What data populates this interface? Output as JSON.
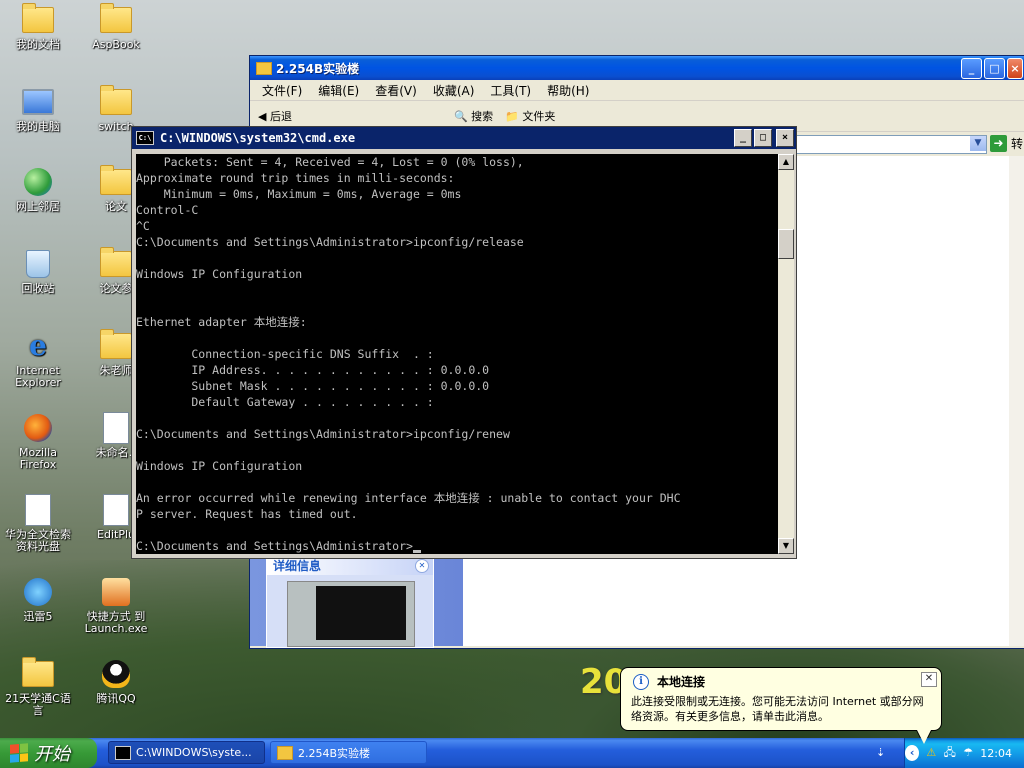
{
  "desktop": {
    "icons": [
      {
        "label": "我的文档",
        "icon": "my-documents-icon"
      },
      {
        "label": "AspBook",
        "icon": "folder-icon"
      },
      {
        "label": "我的电脑",
        "icon": "my-computer-icon"
      },
      {
        "label": "switch",
        "icon": "folder-icon"
      },
      {
        "label": "网上邻居",
        "icon": "network-places-icon"
      },
      {
        "label": "论文",
        "icon": "folder-icon"
      },
      {
        "label": "回收站",
        "icon": "recycle-bin-icon"
      },
      {
        "label": "论文参",
        "icon": "folder-icon"
      },
      {
        "label": "Internet Explorer",
        "icon": "internet-explorer-icon"
      },
      {
        "label": "朱老师",
        "icon": "folder-icon"
      },
      {
        "label": "Mozilla Firefox",
        "icon": "firefox-icon"
      },
      {
        "label": "未命名.t",
        "icon": "document-icon"
      },
      {
        "label": "华为全文检索资料光盘",
        "icon": "huawei-cd-icon"
      },
      {
        "label": "EditPlu",
        "icon": "editplus-icon"
      },
      {
        "label": "迅雷5",
        "icon": "xunlei-icon"
      },
      {
        "label": "快捷方式 到 Launch.exe",
        "icon": "game-shortcut-icon"
      },
      {
        "label": "21天学通C语言",
        "icon": "folder-icon"
      },
      {
        "label": "腾讯QQ",
        "icon": "qq-icon"
      }
    ],
    "background_big_text": "20"
  },
  "explorer": {
    "title": "2.254B实验楼",
    "menu": [
      "文件(F)",
      "编辑(E)",
      "查看(V)",
      "收藏(A)",
      "工具(T)",
      "帮助(H)"
    ],
    "toolbar": {
      "back": "后退",
      "search": "搜索",
      "folders": "文件夹"
    },
    "go_label": "转",
    "details_header": "详细信息"
  },
  "cmd": {
    "title": "C:\\WINDOWS\\system32\\cmd.exe",
    "lines": [
      "    Packets: Sent = 4, Received = 4, Lost = 0 (0% loss),",
      "Approximate round trip times in milli-seconds:",
      "    Minimum = 0ms, Maximum = 0ms, Average = 0ms",
      "Control-C",
      "^C",
      "C:\\Documents and Settings\\Administrator>ipconfig/release",
      "",
      "Windows IP Configuration",
      "",
      "",
      "Ethernet adapter 本地连接:",
      "",
      "        Connection-specific DNS Suffix  . :",
      "        IP Address. . . . . . . . . . . . : 0.0.0.0",
      "        Subnet Mask . . . . . . . . . . . : 0.0.0.0",
      "        Default Gateway . . . . . . . . . :",
      "",
      "C:\\Documents and Settings\\Administrator>ipconfig/renew",
      "",
      "Windows IP Configuration",
      "",
      "An error occurred while renewing interface 本地连接 : unable to contact your DHC",
      "P server. Request has timed out.",
      "",
      "C:\\Documents and Settings\\Administrator>"
    ]
  },
  "balloon": {
    "title": "本地连接",
    "body": "此连接受限制或无连接。您可能无法访问 Internet 或部分网络资源。有关更多信息，请单击此消息。"
  },
  "taskbar": {
    "start_label": "开始",
    "tasks": [
      {
        "label": "C:\\WINDOWS\\syste...",
        "icon": "cmd-icon"
      },
      {
        "label": "2.254B实验楼",
        "icon": "folder-icon"
      }
    ],
    "clock": "12:04"
  }
}
